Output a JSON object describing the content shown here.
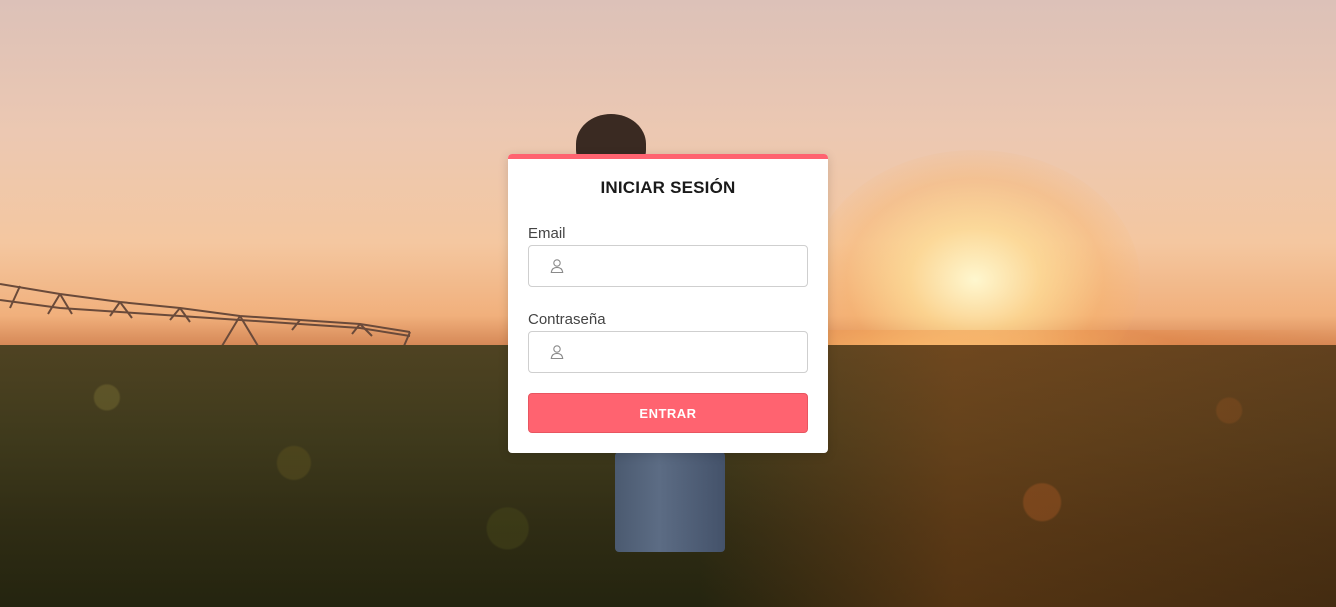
{
  "login": {
    "title": "INICIAR SESIÓN",
    "email_label": "Email",
    "email_value": "",
    "email_icon": "user-icon",
    "password_label": "Contraseña",
    "password_value": "",
    "password_icon": "user-icon",
    "submit_label": "ENTRAR"
  },
  "colors": {
    "accent": "#ff6370",
    "card_background": "#ffffff",
    "input_border": "#cfcfcf"
  }
}
